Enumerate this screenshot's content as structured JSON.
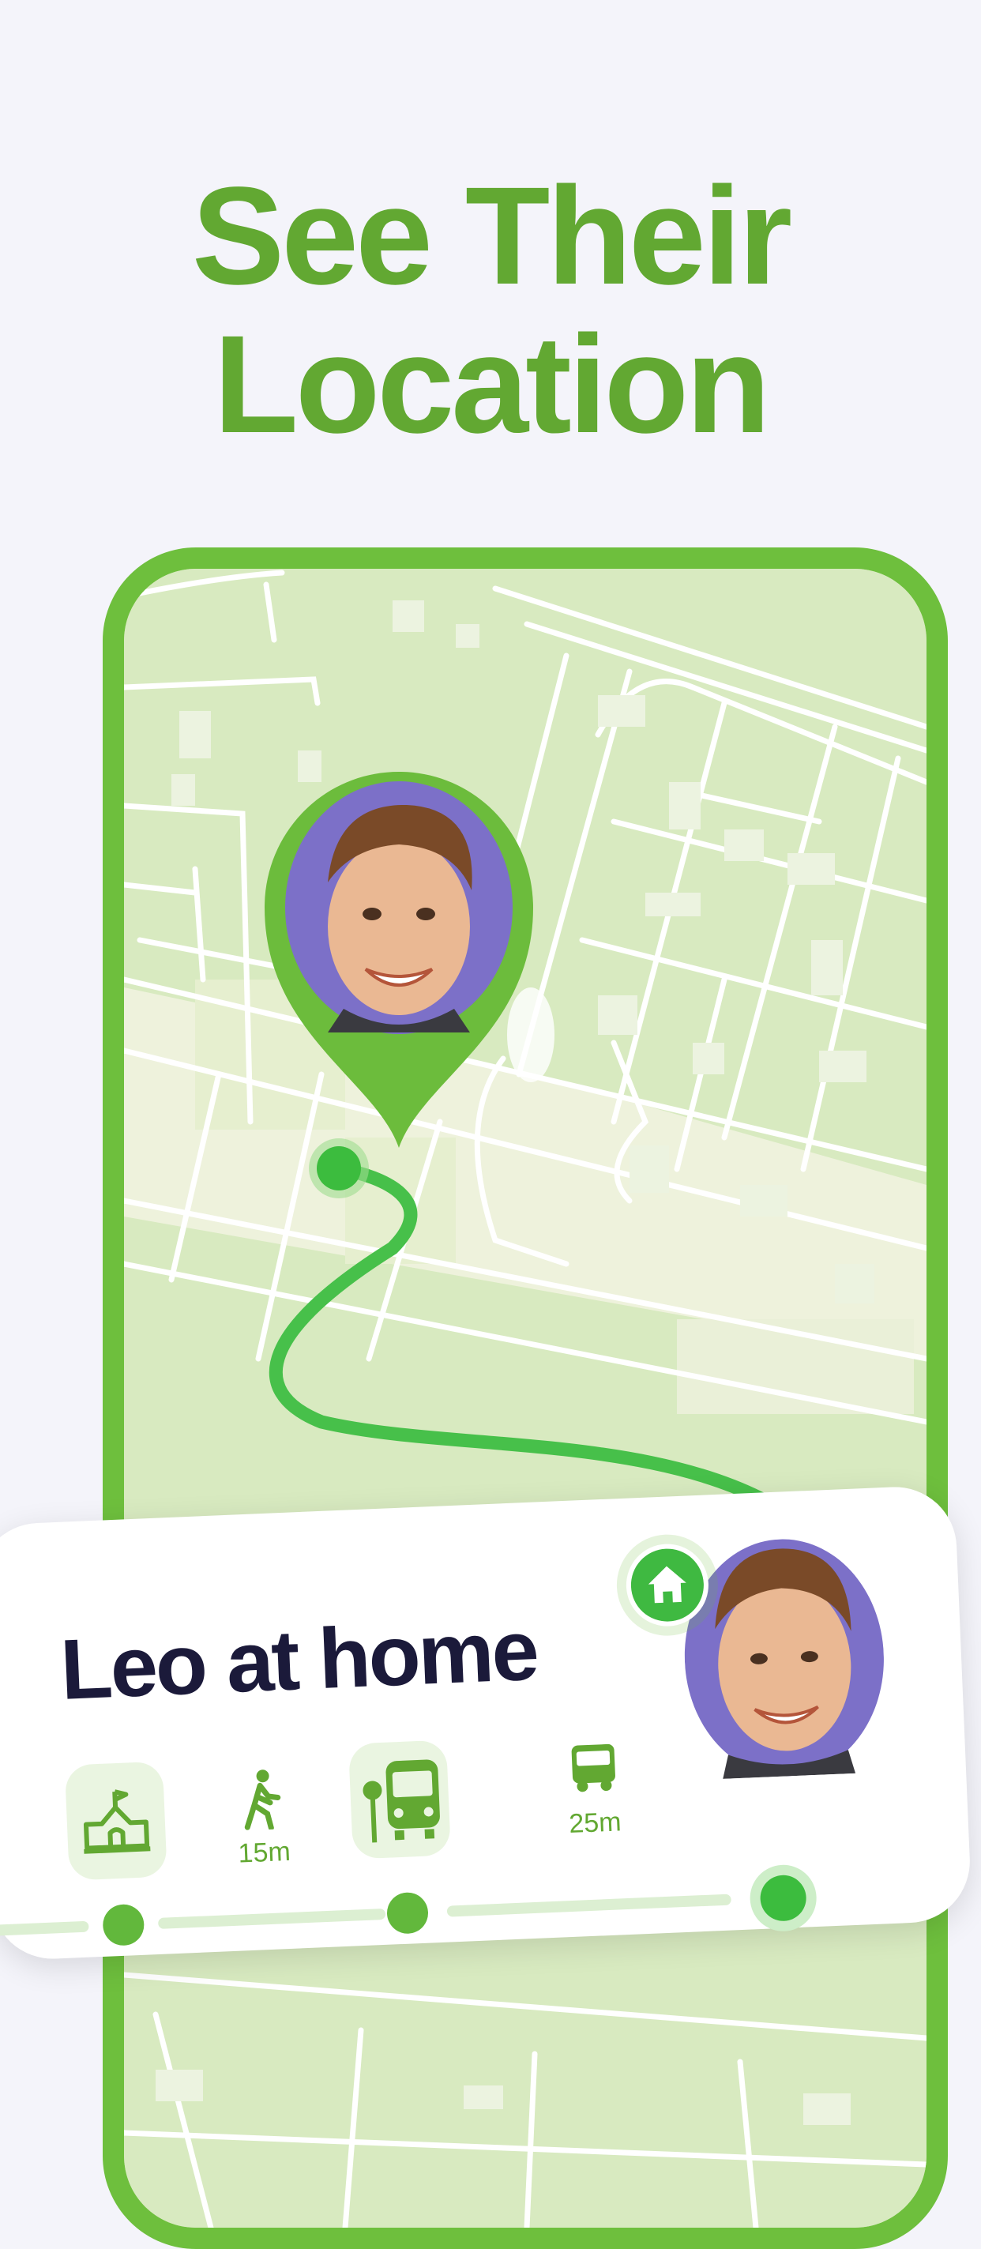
{
  "headline": {
    "line1": "See Their",
    "line2": "Location"
  },
  "colors": {
    "accent": "#62a832",
    "frame": "#6ebf3d",
    "route": "#47c04a",
    "map_bg": "#d8eac0",
    "title_text": "#1b1a3a"
  },
  "map": {
    "pin_icon": "child-location-pin",
    "route_line": "route-path"
  },
  "status_card": {
    "title": "Leo at home",
    "avatar_icon": "child-avatar",
    "badge_icon": "home-icon",
    "steps": [
      {
        "icon": "school-icon",
        "kind": "place"
      },
      {
        "icon": "walking-icon",
        "duration": "15m",
        "kind": "transit"
      },
      {
        "icon": "bus-stop-icon",
        "kind": "place"
      },
      {
        "icon": "bus-icon",
        "duration": "25m",
        "kind": "transit"
      },
      {
        "icon": "home-marker",
        "kind": "destination"
      }
    ]
  }
}
